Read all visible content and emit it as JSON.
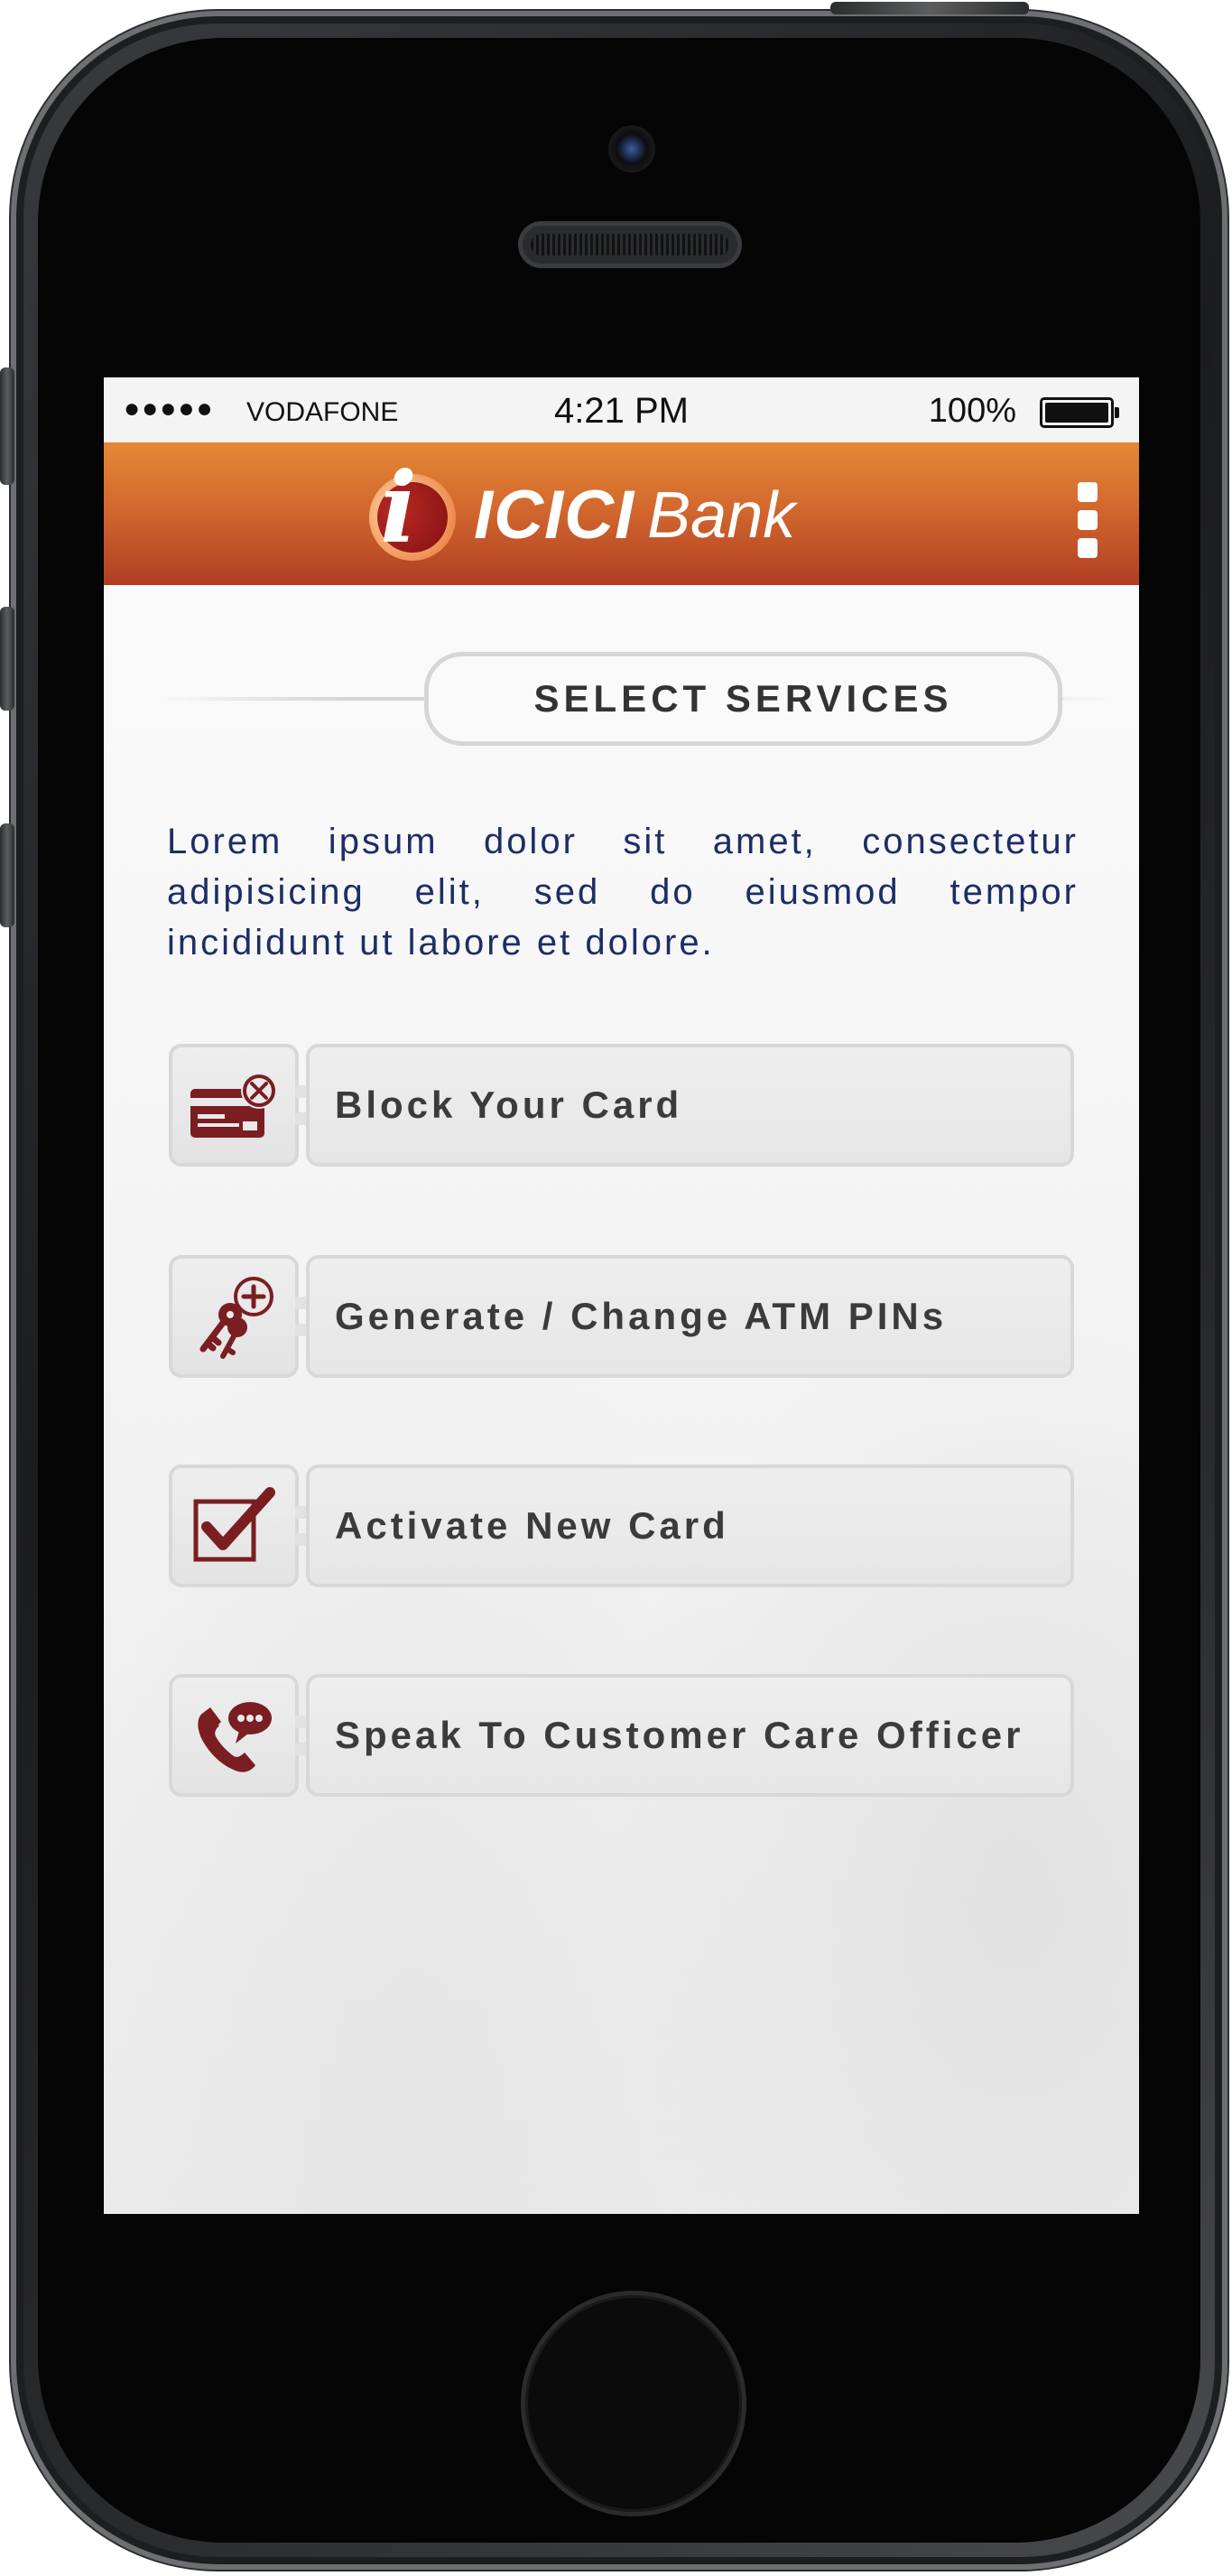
{
  "status_bar": {
    "signal": "●●●●●",
    "carrier": "VODAFONE",
    "time": "4:21 PM",
    "battery_percent": "100%",
    "battery_level": 1.0
  },
  "header": {
    "logo_glyph": "i",
    "logo_text_bold": "ICICI",
    "logo_text_regular": "Bank",
    "menu_icon": "vertical-dots-menu-icon",
    "brand_colors": [
      "#e58834",
      "#b03e23"
    ]
  },
  "section_title": "SELECT SERVICES",
  "intro_text": "Lorem ipsum dolor sit amet, consectetur adipisicing elit, sed do eiusmod tempor incididunt ut labore et dolore.",
  "services": [
    {
      "label": "Block Your Card",
      "icon": "block-card-icon"
    },
    {
      "label": "Generate / Change ATM PINs",
      "icon": "keys-icon"
    },
    {
      "label": "Activate New Card",
      "icon": "checkbox-icon"
    },
    {
      "label": "Speak To Customer Care Officer",
      "icon": "phone-chat-icon"
    }
  ],
  "colors": {
    "icon_color": "#7a1e22",
    "text_color": "#1e2d66",
    "label_color": "#3b3b3b"
  }
}
